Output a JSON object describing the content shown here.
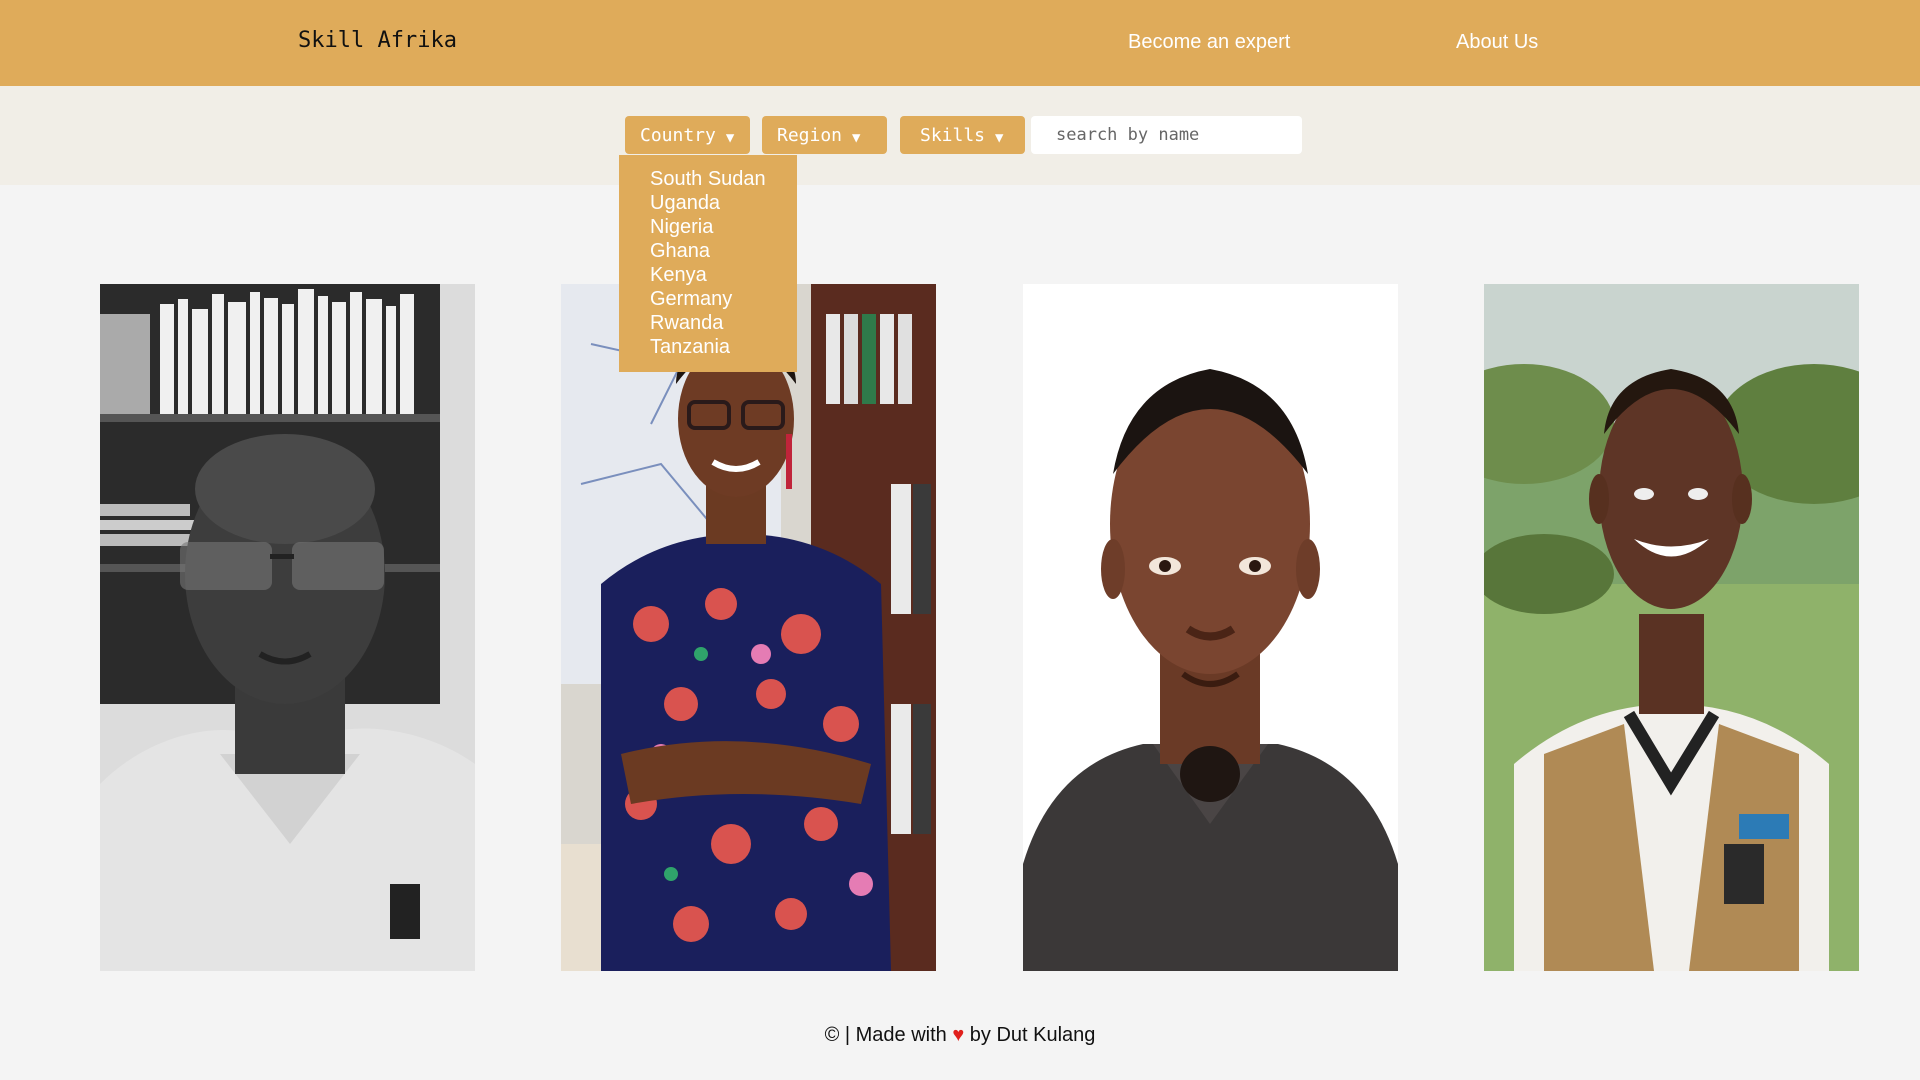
{
  "navbar": {
    "brand": "Skill Afrika",
    "links": [
      {
        "label": "Become an expert"
      },
      {
        "label": "About Us"
      }
    ],
    "background": "#dfab5a"
  },
  "filters": {
    "country_label": "Country",
    "region_label": "Region",
    "skills_label": "Skills",
    "caret": "▼",
    "search_placeholder": "search by name"
  },
  "country_dropdown": {
    "open": true,
    "options": [
      "South Sudan",
      "Uganda",
      "Nigeria",
      "Ghana",
      "Kenya",
      "Germany",
      "Rwanda",
      "Tanzania"
    ]
  },
  "experts": [
    {
      "photo": "portrait-grayscale-man-glasses"
    },
    {
      "photo": "portrait-woman-floral-dress"
    },
    {
      "photo": "portrait-man-white-background"
    },
    {
      "photo": "portrait-young-man-outdoors"
    }
  ],
  "footer": {
    "icon": "copyright-icon",
    "copyright_symbol": "©",
    "prefix": "| Made with",
    "heart": "♥",
    "suffix": "by Dut Kulang"
  },
  "colors": {
    "accent": "#dfab5a",
    "filter_bar": "#f1eee7",
    "page_bg": "#f4f4f4",
    "heart": "#e0201c"
  }
}
